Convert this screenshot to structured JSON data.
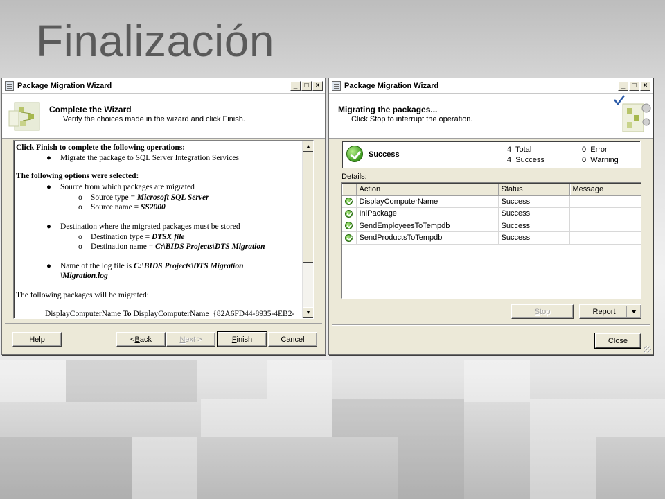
{
  "slide": {
    "title": "Finalización"
  },
  "left_dialog": {
    "window_title": "Package Migration Wizard",
    "header_title": "Complete the Wizard",
    "header_subtitle": "Verify the choices made in the wizard and click Finish.",
    "summary": {
      "op_heading": "Click Finish to complete the following operations:",
      "op_item": "Migrate the package to SQL Server Integration Services",
      "opt_heading": "The following options were selected:",
      "source_item": "Source from which packages are migrated",
      "source_type_label": "Source type = ",
      "source_type_value": "Microsoft SQL Server",
      "source_name_label": "Source name = ",
      "source_name_value": "SS2000",
      "dest_item": "Destination where the migrated packages must be stored",
      "dest_type_label": "Destination type = ",
      "dest_type_value": "DTSX file",
      "dest_name_label": "Destination name = ",
      "dest_name_value": "C:\\BIDS Projects\\DTS Migration",
      "log_label": "Name of the log file is ",
      "log_value_1": "C:\\BIDS Projects\\DTS Migration",
      "log_value_2": "\\Migration.log",
      "packages_heading": "The following packages will be migrated:",
      "pkg_name": "DisplayComputerName",
      "pkg_to": "To",
      "pkg_target": "DisplayComputerName_{82A6FD44-8935-4EB2-"
    },
    "buttons": {
      "help": "Help",
      "back_prefix": "< ",
      "back_key": "B",
      "back_rest": "ack",
      "next_key": "N",
      "next_rest": "ext >",
      "finish_key": "F",
      "finish_rest": "inish",
      "cancel": "Cancel"
    }
  },
  "right_dialog": {
    "window_title": "Package Migration Wizard",
    "header_title": "Migrating the packages...",
    "header_subtitle": "Click Stop to interrupt the operation.",
    "status": "Success",
    "counts": {
      "total_num": "4",
      "total_label": "Total",
      "success_num": "4",
      "success_label": "Success",
      "error_num": "0",
      "error_label": "Error",
      "warning_num": "0",
      "warning_label": "Warning"
    },
    "details_key": "D",
    "details_rest": "etails:",
    "columns": [
      "Action",
      "Status",
      "Message"
    ],
    "rows": [
      {
        "action": "DisplayComputerName",
        "status": "Success",
        "message": ""
      },
      {
        "action": "IniPackage",
        "status": "Success",
        "message": ""
      },
      {
        "action": "SendEmployeesToTempdb",
        "status": "Success",
        "message": ""
      },
      {
        "action": "SendProductsToTempdb",
        "status": "Success",
        "message": ""
      }
    ],
    "buttons": {
      "stop_key": "S",
      "stop_rest": "top",
      "report_key": "R",
      "report_rest": "eport",
      "close_key": "C",
      "close_rest": "lose"
    }
  },
  "colors": {
    "dialog_face": "#ece9d8",
    "success_green": "#3c9a1e",
    "title_gray": "#5a5a5a"
  }
}
